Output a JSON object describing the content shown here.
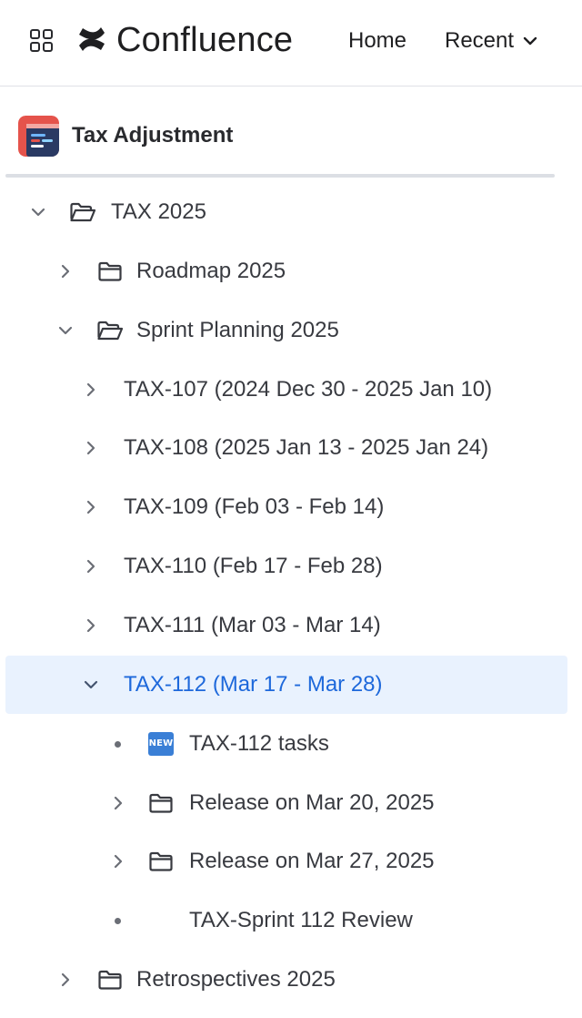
{
  "header": {
    "brand": "Confluence",
    "nav": {
      "home": "Home",
      "recent": "Recent"
    }
  },
  "space": {
    "title": "Tax Adjustment"
  },
  "tree": {
    "items": [
      {
        "label": "TAX 2025",
        "level": 0,
        "toggle": "expanded",
        "icon": "folder-open-icon"
      },
      {
        "label": "Roadmap 2025",
        "level": 1,
        "toggle": "collapsed",
        "icon": "folder-icon"
      },
      {
        "label": "Sprint Planning 2025",
        "level": 1,
        "toggle": "expanded",
        "icon": "folder-open-icon"
      },
      {
        "label": "TAX-107 (2024 Dec 30 - 2025 Jan 10)",
        "level": 2,
        "toggle": "collapsed",
        "icon": ""
      },
      {
        "label": "TAX-108 (2025 Jan 13 - 2025 Jan 24)",
        "level": 2,
        "toggle": "collapsed",
        "icon": ""
      },
      {
        "label": "TAX-109 (Feb 03 - Feb 14)",
        "level": 2,
        "toggle": "collapsed",
        "icon": ""
      },
      {
        "label": "TAX-110 (Feb 17 - Feb 28)",
        "level": 2,
        "toggle": "collapsed",
        "icon": ""
      },
      {
        "label": "TAX-111 (Mar 03 - Mar 14)",
        "level": 2,
        "toggle": "collapsed",
        "icon": ""
      },
      {
        "label": "TAX-112 (Mar 17 - Mar 28)",
        "level": 2,
        "toggle": "expanded",
        "icon": "",
        "selected": true
      },
      {
        "label": "TAX-112 tasks",
        "level": 3,
        "toggle": "leaf",
        "icon": "new-emoji-icon",
        "badge": "NEW"
      },
      {
        "label": "Release on Mar 20, 2025",
        "level": 3,
        "toggle": "collapsed",
        "icon": "folder-icon"
      },
      {
        "label": "Release on Mar 27, 2025",
        "level": 3,
        "toggle": "collapsed",
        "icon": "folder-icon"
      },
      {
        "label": "TAX-Sprint 112 Review",
        "level": 3,
        "toggle": "leaf",
        "icon": ""
      },
      {
        "label": "Retrospectives 2025",
        "level": 1,
        "toggle": "collapsed",
        "icon": "folder-icon"
      }
    ]
  },
  "colors": {
    "selected_bg": "#e9f2fe",
    "selected_text": "#1d68db",
    "text": "#383a40"
  }
}
